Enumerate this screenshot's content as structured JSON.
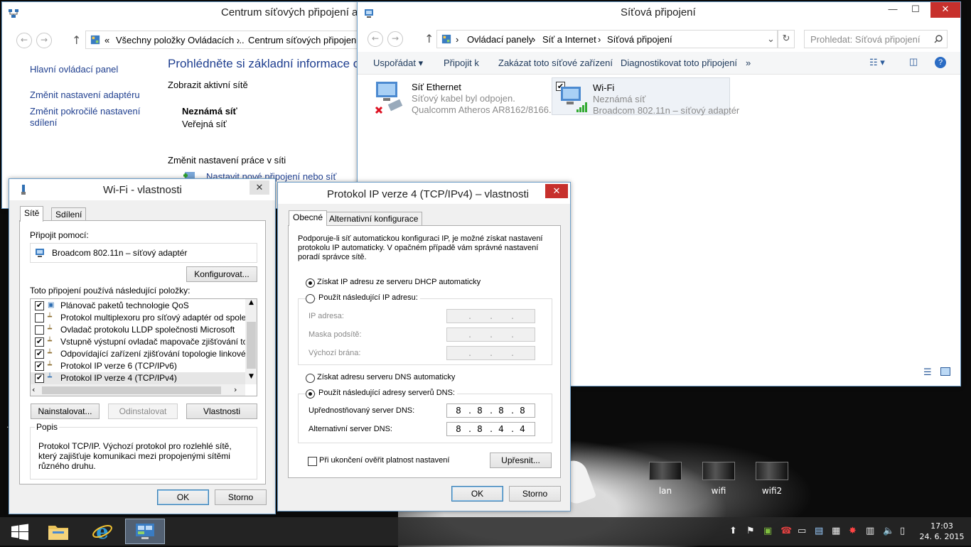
{
  "desktop": {
    "icons": [
      {
        "label": "lan"
      },
      {
        "label": "wifi"
      },
      {
        "label": "wifi2"
      }
    ]
  },
  "network_center": {
    "title": "Centrum síťových připojení a",
    "breadcrumb_prefix": "«",
    "breadcrumb": [
      "Všechny položky Ovládacích ...",
      "Centrum síťových připojení a"
    ],
    "sidebar": [
      "Hlavní ovládací panel",
      "Změnit nastavení adaptéru",
      "Změnit pokročilé nastavení sdílení"
    ],
    "heading": "Prohlédněte si základní informace o sí",
    "active_networks_label": "Zobrazit aktivní sítě",
    "network_name": "Neznámá síť",
    "network_type": "Veřejná síť",
    "change_settings_label": "Změnit nastavení práce v síti",
    "new_connection_link": "Nastavit nové připojení nebo síť"
  },
  "connections": {
    "title": "Síťová připojení",
    "breadcrumb": [
      "Ovládací panely",
      "Síť a Internet",
      "Síťová připojení"
    ],
    "search_placeholder": "Prohledat: Síťová připojení",
    "commands": [
      "Uspořádat",
      "Připojit k",
      "Zakázat toto síťové zařízení",
      "Diagnostikovat toto připojení",
      "»"
    ],
    "adapters": [
      {
        "name": "Síť Ethernet",
        "status": "Síťový kabel byl odpojen.",
        "device": "Qualcomm Atheros AR8162/8166..."
      },
      {
        "name": "Wi-Fi",
        "status": "Neznámá síť",
        "device": "Broadcom 802.11n – síťový adaptér"
      }
    ]
  },
  "wifi_props": {
    "title": "Wi-Fi - vlastnosti",
    "tabs": [
      "Sítě",
      "Sdílení"
    ],
    "connect_using_label": "Připojit pomocí:",
    "adapter": "Broadcom 802.11n – síťový adaptér",
    "configure_button": "Konfigurovat...",
    "items_label": "Toto připojení používá následující položky:",
    "items": [
      {
        "label": "Plánovač paketů technologie QoS",
        "checked": "✔"
      },
      {
        "label": "Protokol multiplexoru pro síťový adaptér od společnosti",
        "checked": ""
      },
      {
        "label": "Ovladač protokolu LLDP společnosti Microsoft",
        "checked": ""
      },
      {
        "label": "Vstupně výstupní ovladač mapovače zjišťování topolo",
        "checked": "✔"
      },
      {
        "label": "Odpovídající zařízení zjišťování topologie linkové vrst",
        "checked": "✔"
      },
      {
        "label": "Protokol IP verze 6 (TCP/IPv6)",
        "checked": "✔"
      },
      {
        "label": "Protokol IP verze 4 (TCP/IPv4)",
        "checked": "✔"
      }
    ],
    "install_button": "Nainstalovat...",
    "uninstall_button": "Odinstalovat",
    "properties_button": "Vlastnosti",
    "description_label": "Popis",
    "description": "Protokol TCP/IP. Výchozí protokol pro rozlehlé sítě, který zajišťuje komunikaci mezi propojenými sítěmi různého druhu.",
    "ok": "OK",
    "cancel": "Storno"
  },
  "ipv4": {
    "title": "Protokol IP verze 4 (TCP/IPv4) – vlastnosti",
    "tabs": [
      "Obecné",
      "Alternativní konfigurace"
    ],
    "intro": "Podporuje-li síť automatickou konfiguraci IP, je možné získat nastavení protokolu IP automaticky. V opačném případě vám správné nastavení poradí správce sítě.",
    "auto_ip": "Získat IP adresu ze serveru DHCP automaticky",
    "manual_ip": "Použít následující IP adresu:",
    "ip_label": "IP adresa:",
    "mask_label": "Maska podsítě:",
    "gateway_label": "Výchozí brána:",
    "auto_dns": "Získat adresu serveru DNS automaticky",
    "manual_dns": "Použít následující adresy serverů DNS:",
    "pref_dns_label": "Upřednostňovaný server DNS:",
    "pref_dns": [
      "8",
      "8",
      "8",
      "8"
    ],
    "alt_dns_label": "Alternativní server DNS:",
    "alt_dns": [
      "8",
      "8",
      "4",
      "4"
    ],
    "validate_label": "Při ukončení ověřit platnost nastavení",
    "advanced_button": "Upřesnit...",
    "ok": "OK",
    "cancel": "Storno"
  },
  "taskbar": {
    "time": "17:03",
    "date": "24. 6. 2015"
  }
}
